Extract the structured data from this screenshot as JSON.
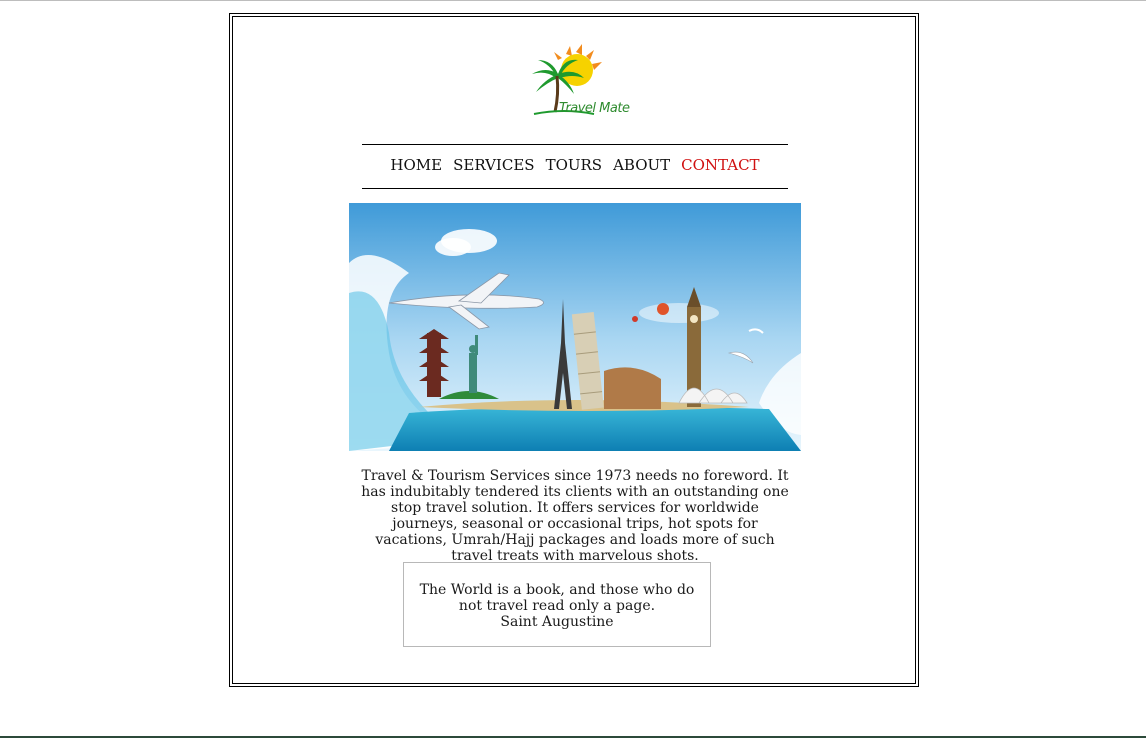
{
  "brand": {
    "name": "Travel Mate",
    "logo_icon": "palm-sun-logo-icon"
  },
  "nav": {
    "items": [
      {
        "label": "HOME",
        "active": false
      },
      {
        "label": "SERVICES",
        "active": false
      },
      {
        "label": "TOURS",
        "active": false
      },
      {
        "label": "ABOUT",
        "active": false
      },
      {
        "label": "CONTACT",
        "active": true
      }
    ]
  },
  "hero": {
    "icon": "world-landmarks-hero-image"
  },
  "intro": {
    "text": "Travel & Tourism Services since 1973 needs no foreword. It has indubitably tendered its clients with an outstanding one stop travel solution. It offers services for worldwide journeys, seasonal or occasional trips, hot spots for vacations, Umrah/Hajj packages and loads more of such travel treats with marvelous shots."
  },
  "quote": {
    "text": "The World is a book, and those who do not travel read only a page.",
    "author": "Saint Augustine"
  },
  "colors": {
    "active_nav": "#d01010",
    "logo_green": "#2e8b2e",
    "sun_yellow": "#f6d200",
    "sun_orange": "#f28c1e"
  }
}
